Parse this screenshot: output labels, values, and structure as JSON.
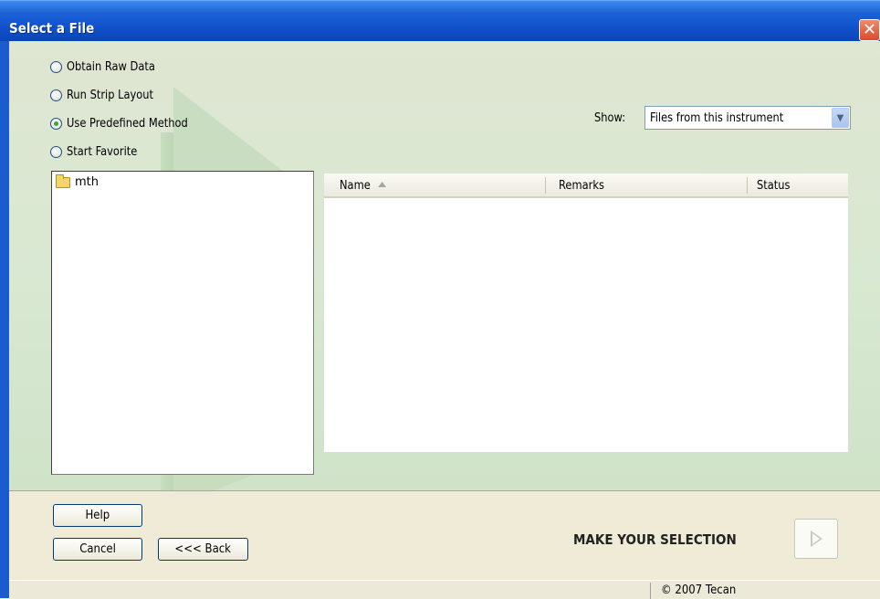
{
  "window": {
    "title": "Select a File",
    "close_symbol": "✕"
  },
  "options": [
    {
      "label": "Obtain Raw Data",
      "selected": false
    },
    {
      "label": "Run Strip Layout",
      "selected": false
    },
    {
      "label": "Use Predefined Method",
      "selected": true
    },
    {
      "label": "Start Favorite",
      "selected": false
    }
  ],
  "show": {
    "label": "Show:",
    "value": "Files from this instrument"
  },
  "tree": {
    "items": [
      {
        "label": "mth",
        "icon": "folder-icon"
      }
    ]
  },
  "table": {
    "columns": [
      "Name",
      "Remarks",
      "Status"
    ],
    "sort_column": "Name",
    "rows": []
  },
  "buttons": {
    "help": "Help",
    "cancel": "Cancel",
    "back": "<<< Back"
  },
  "status": {
    "message": "MAKE YOUR SELECTION",
    "copyright": "© 2007 Tecan"
  }
}
